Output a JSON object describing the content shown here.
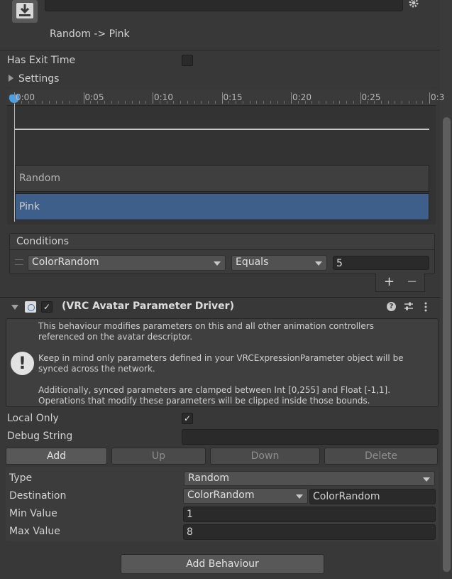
{
  "transition": {
    "title": "Random -> Pink"
  },
  "settings": {
    "has_exit_time_label": "Has Exit Time",
    "settings_label": "Settings"
  },
  "timeline": {
    "ticks": [
      "0:00",
      "0:05",
      "0:10",
      "0:15",
      "0:20",
      "0:25",
      "0:3"
    ],
    "state_from": "Random",
    "state_to": "Pink"
  },
  "conditions": {
    "header": "Conditions",
    "parameter": "ColorRandom",
    "mode": "Equals",
    "value": "5",
    "add_label": "+",
    "remove_label": "−"
  },
  "driver": {
    "title": "(VRC Avatar Parameter Driver)",
    "info1": "This behaviour modifies parameters on this and all other animation controllers referenced on the avatar descriptor.",
    "info2": "Keep in mind only parameters defined in your VRCExpressionParameter object will be synced across the network.",
    "info3": "Additionally, synced parameters are clamped between Int [0,255] and Float [-1,1]. Operations that modify these parameters will be clipped inside those bounds.",
    "local_only_label": "Local Only",
    "debug_string_label": "Debug String",
    "debug_string_value": "",
    "buttons": {
      "add": "Add",
      "up": "Up",
      "down": "Down",
      "delete": "Delete"
    },
    "type_label": "Type",
    "type_value": "Random",
    "destination_label": "Destination",
    "destination_dropdown": "ColorRandom",
    "destination_value": "ColorRandom",
    "min_label": "Min Value",
    "min_value": "1",
    "max_label": "Max Value",
    "max_value": "8"
  },
  "footer": {
    "add_behaviour": "Add Behaviour"
  },
  "colors": {
    "selected": "#3e5f8a",
    "background": "#383838"
  }
}
